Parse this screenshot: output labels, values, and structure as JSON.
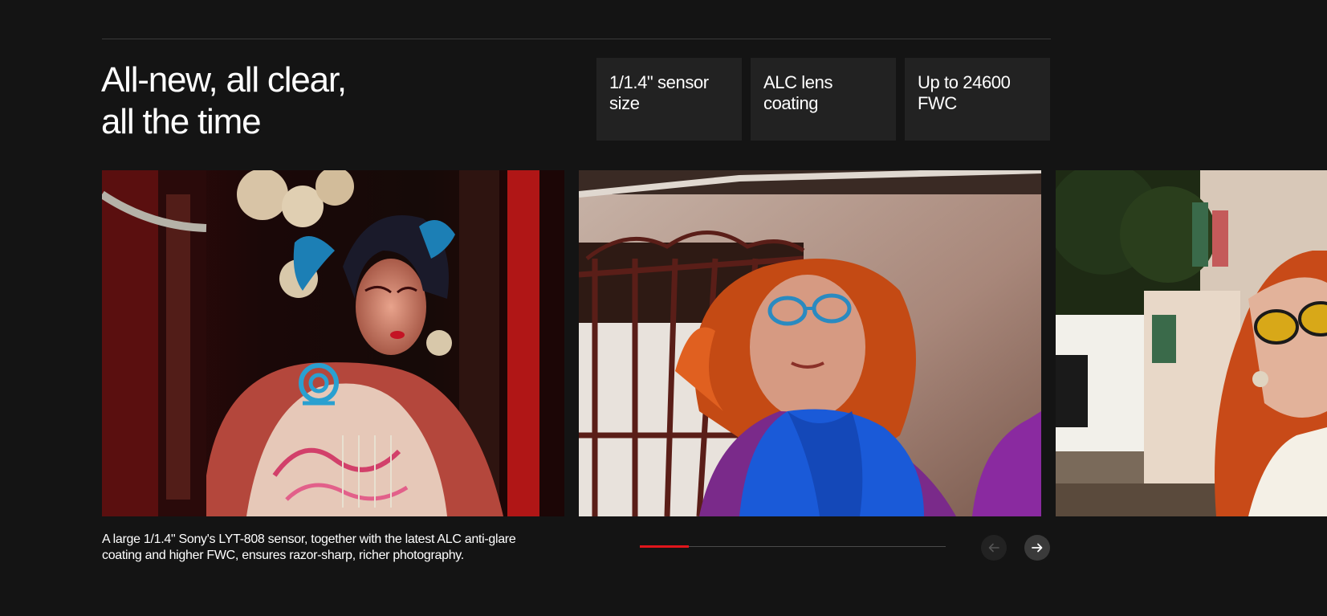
{
  "heading": {
    "line1": "All-new, all clear,",
    "line2": "all the time"
  },
  "features": [
    {
      "label": "1/1.4\" sensor size"
    },
    {
      "label": "ALC lens coating"
    },
    {
      "label": "Up to 24600 FWC"
    }
  ],
  "carousel": {
    "caption": "A large 1/1.4\" Sony's LYT-808 sensor, together with the latest ALC anti-glare coating and higher FWC, ensures razor-sharp, richer photography.",
    "progress": 0.16,
    "slides": [
      {
        "subject": "opera performer in traditional headdress"
      },
      {
        "subject": "woman with red curly hair, glasses and blue scarf"
      },
      {
        "subject": "woman with orange hair and yellow sunglasses on a street"
      }
    ],
    "prev_icon": "arrow-left-icon",
    "next_icon": "arrow-right-icon"
  },
  "colors": {
    "background": "#141414",
    "card": "#222222",
    "accent": "#e0151b"
  }
}
